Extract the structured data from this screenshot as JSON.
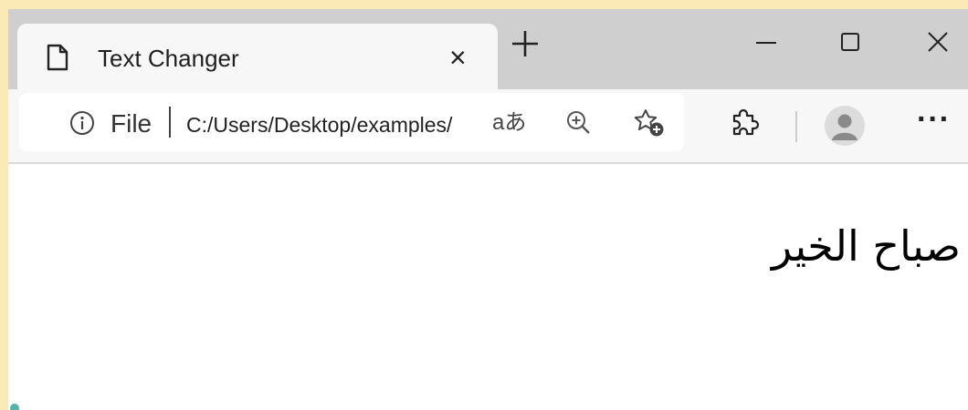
{
  "tab": {
    "title": "Text Changer"
  },
  "address_bar": {
    "scheme": "File",
    "url": "C:/Users/Desktop/examples/",
    "read_aloud_label": "aあ"
  },
  "toolbar": {
    "more_label": "···"
  },
  "page": {
    "greeting": "صباح الخير"
  }
}
